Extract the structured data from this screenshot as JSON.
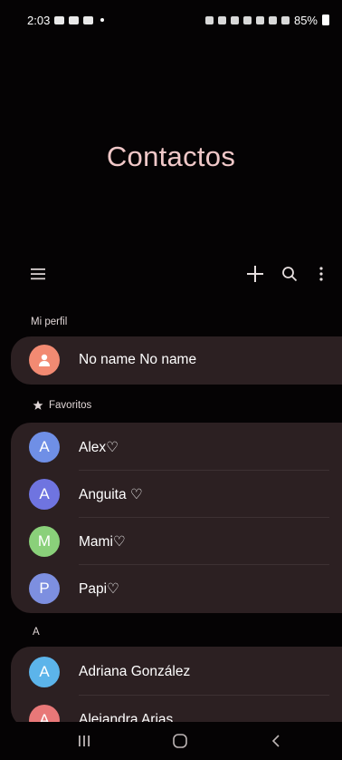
{
  "status_bar": {
    "time": "2:03",
    "battery": "85%"
  },
  "header": {
    "title": "Contactos"
  },
  "toolbar": {
    "menu_icon": "menu-icon",
    "add_icon": "plus-icon",
    "search_icon": "search-icon",
    "more_icon": "more-vertical-icon"
  },
  "profile": {
    "section_label": "Mi perfil",
    "name": "No name No name",
    "avatar_color": "#f28a72"
  },
  "favorites": {
    "section_label": "Favoritos",
    "items": [
      {
        "initial": "A",
        "name": "Alex♡",
        "color": "#6f8fe6"
      },
      {
        "initial": "A",
        "name": "Anguita ♡",
        "color": "#6f74e0"
      },
      {
        "initial": "M",
        "name": "Mami♡",
        "color": "#8ad07a"
      },
      {
        "initial": "P",
        "name": "Papi♡",
        "color": "#7d8fe0"
      }
    ]
  },
  "section_a": {
    "section_label": "A",
    "items": [
      {
        "initial": "A",
        "name": "Adriana González",
        "color": "#5cb4ea"
      },
      {
        "initial": "A",
        "name": "Alejandra Arias",
        "color": "#e87878"
      }
    ]
  },
  "colors": {
    "background": "#050304",
    "card": "#2c2022",
    "title": "#f0c8c8"
  }
}
